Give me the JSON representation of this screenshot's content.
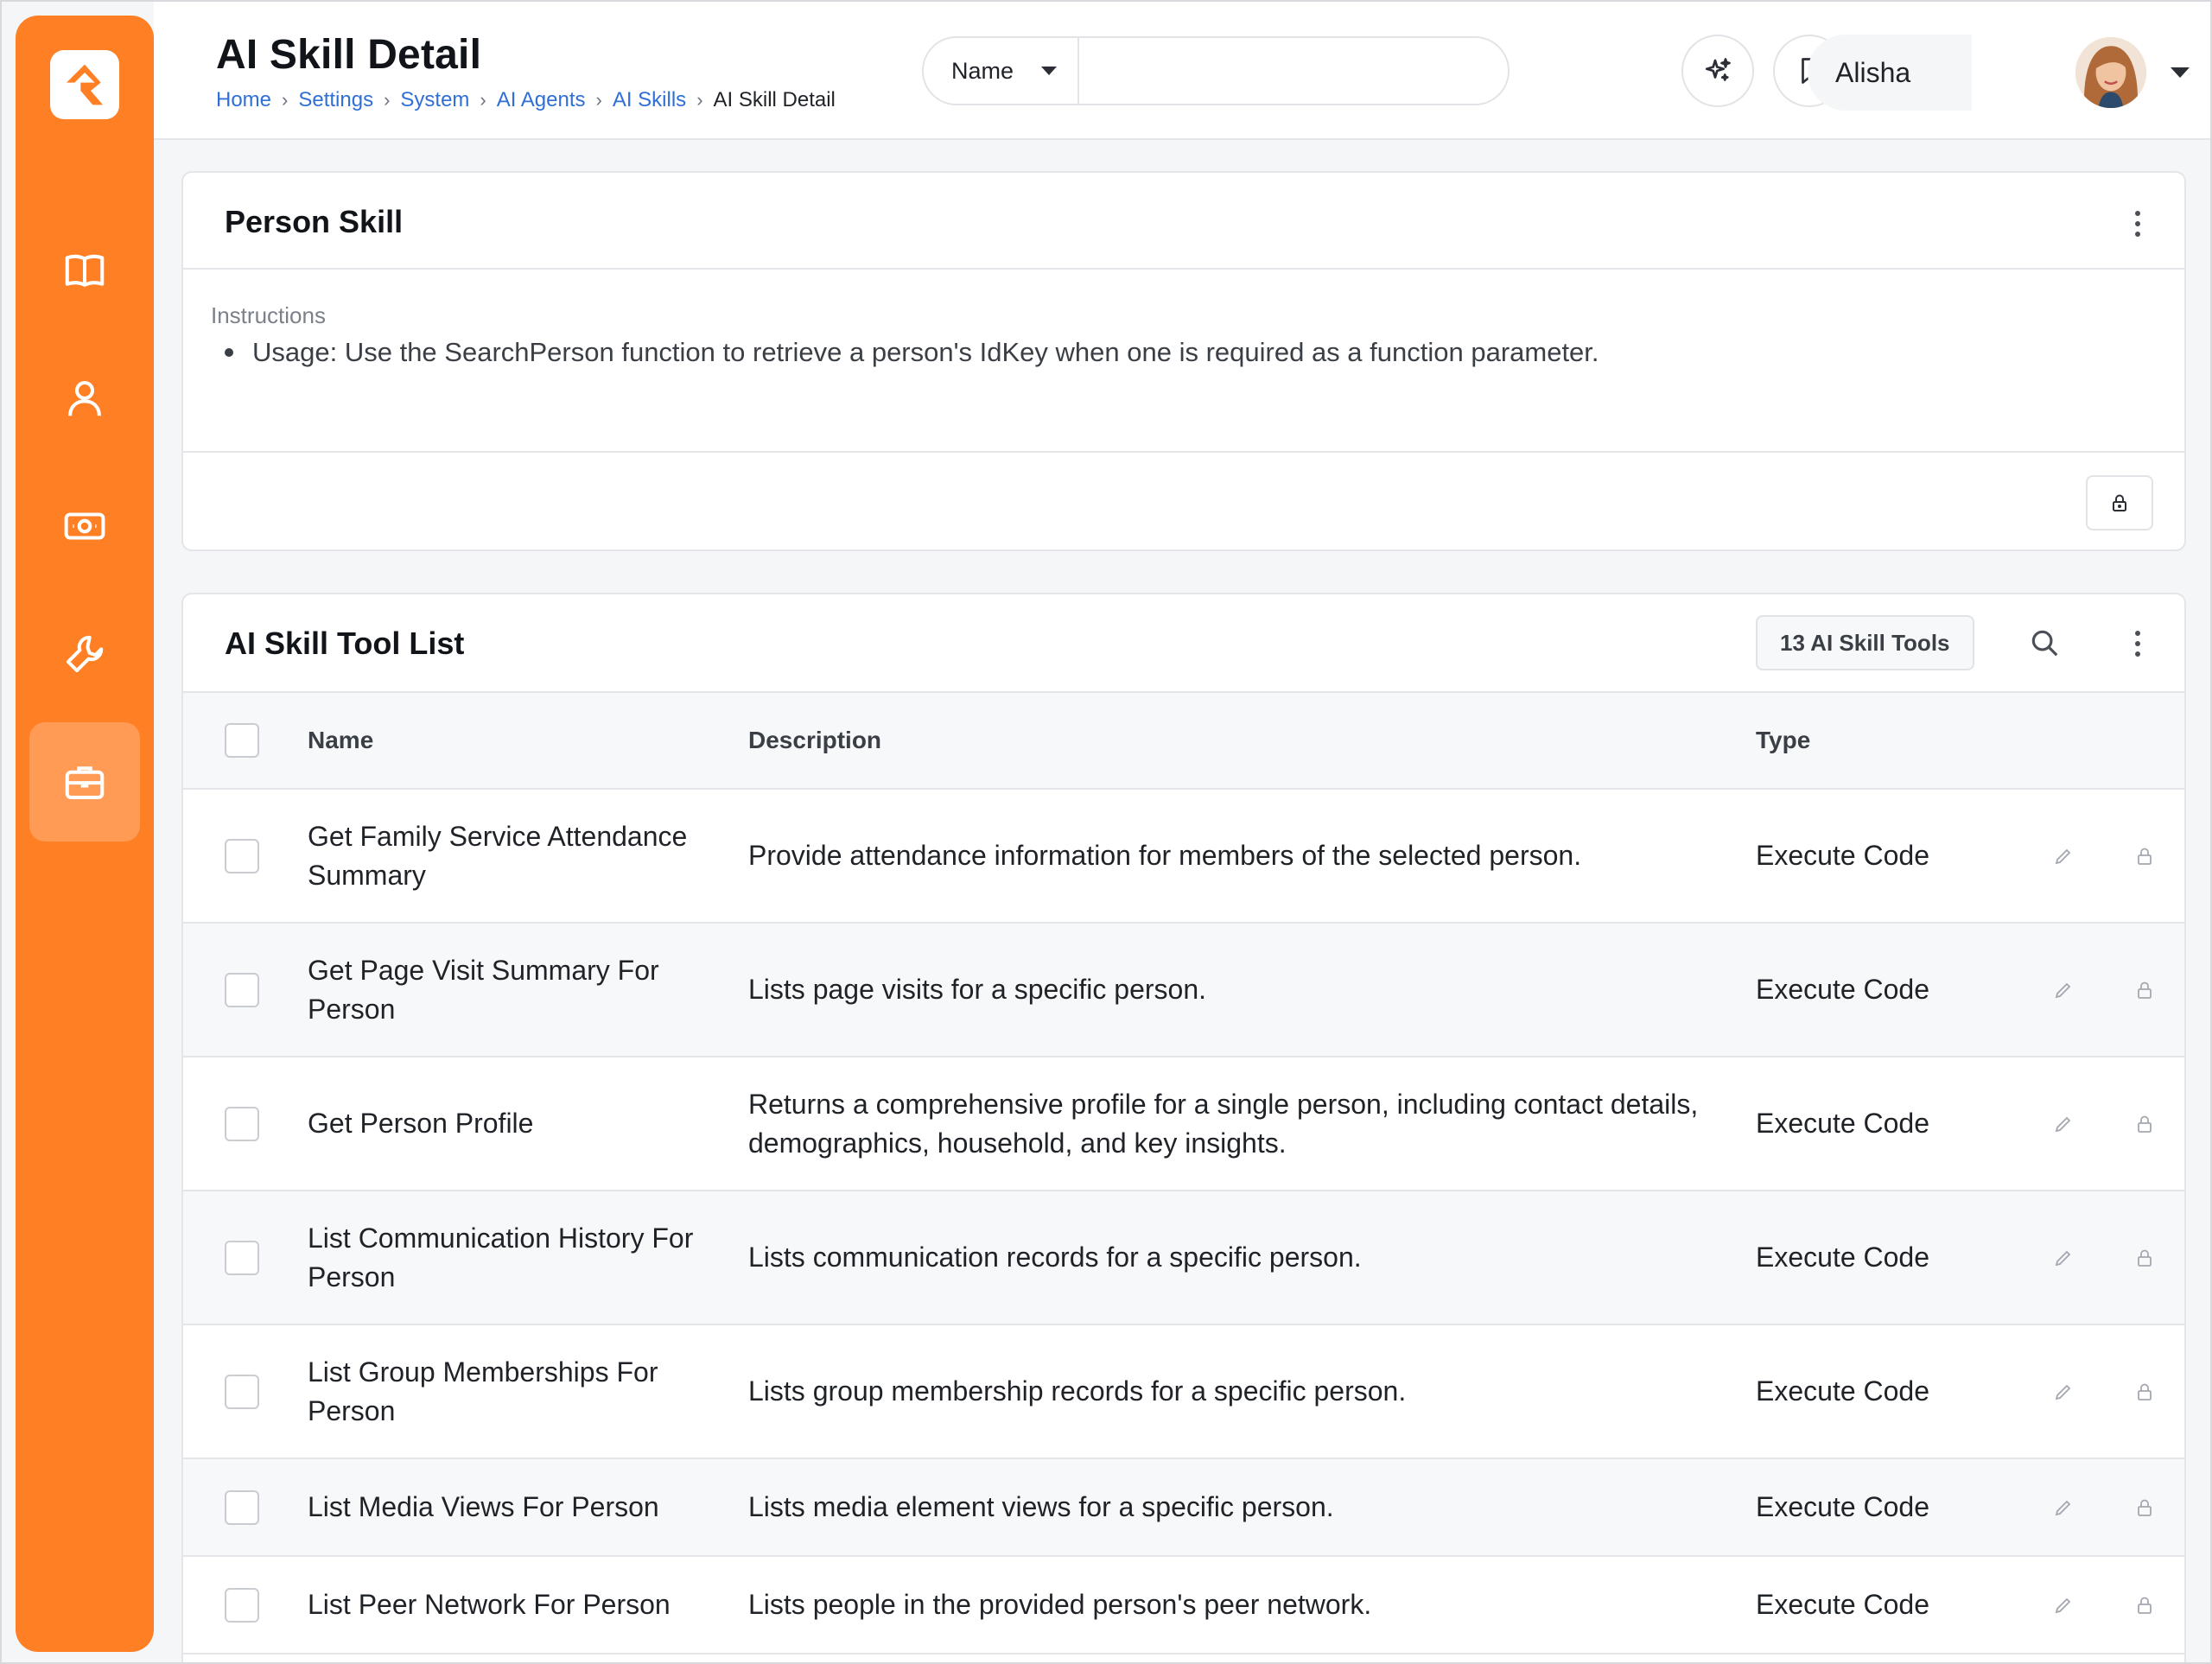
{
  "header": {
    "title": "AI Skill Detail",
    "breadcrumb": [
      "Home",
      "Settings",
      "System",
      "AI Agents",
      "AI Skills"
    ],
    "breadcrumb_current": "AI Skill Detail",
    "search": {
      "filter_label": "Name",
      "value": ""
    },
    "user_name": "Alisha"
  },
  "colors": {
    "brand_orange": "#ff7f24",
    "link_blue": "#2f6fd6",
    "notification_dot": "#ff7f24"
  },
  "sidebar": {
    "items": [
      {
        "icon": "book-icon"
      },
      {
        "icon": "person-icon"
      },
      {
        "icon": "money-icon"
      },
      {
        "icon": "wrench-icon"
      },
      {
        "icon": "briefcase-icon",
        "active": true
      }
    ]
  },
  "skill_card": {
    "title": "Person Skill",
    "instructions_label": "Instructions",
    "instructions": [
      "Usage: Use the SearchPerson function to retrieve a person's IdKey when one is required as a function parameter."
    ]
  },
  "tool_list": {
    "title": "AI Skill Tool List",
    "count_label": "13 AI Skill Tools",
    "columns": {
      "name": "Name",
      "description": "Description",
      "type": "Type"
    },
    "rows": [
      {
        "name": "Get Family Service Attendance Summary",
        "description": "Provide attendance information for members of the selected person.",
        "type": "Execute Code"
      },
      {
        "name": "Get Page Visit Summary For Person",
        "description": "Lists page visits for a specific person.",
        "type": "Execute Code"
      },
      {
        "name": "Get Person Profile",
        "description": "Returns a comprehensive profile for a single person, including contact details, demographics, household, and key insights.",
        "type": "Execute Code"
      },
      {
        "name": "List Communication History For Person",
        "description": "Lists communication records for a specific person.",
        "type": "Execute Code"
      },
      {
        "name": "List Group Memberships For Person",
        "description": "Lists group membership records for a specific person.",
        "type": "Execute Code"
      },
      {
        "name": "List Media Views For Person",
        "description": "Lists media element views for a specific person.",
        "type": "Execute Code"
      },
      {
        "name": "List Peer Network For Person",
        "description": "Lists people in the provided person's peer network.",
        "type": "Execute Code"
      }
    ]
  }
}
